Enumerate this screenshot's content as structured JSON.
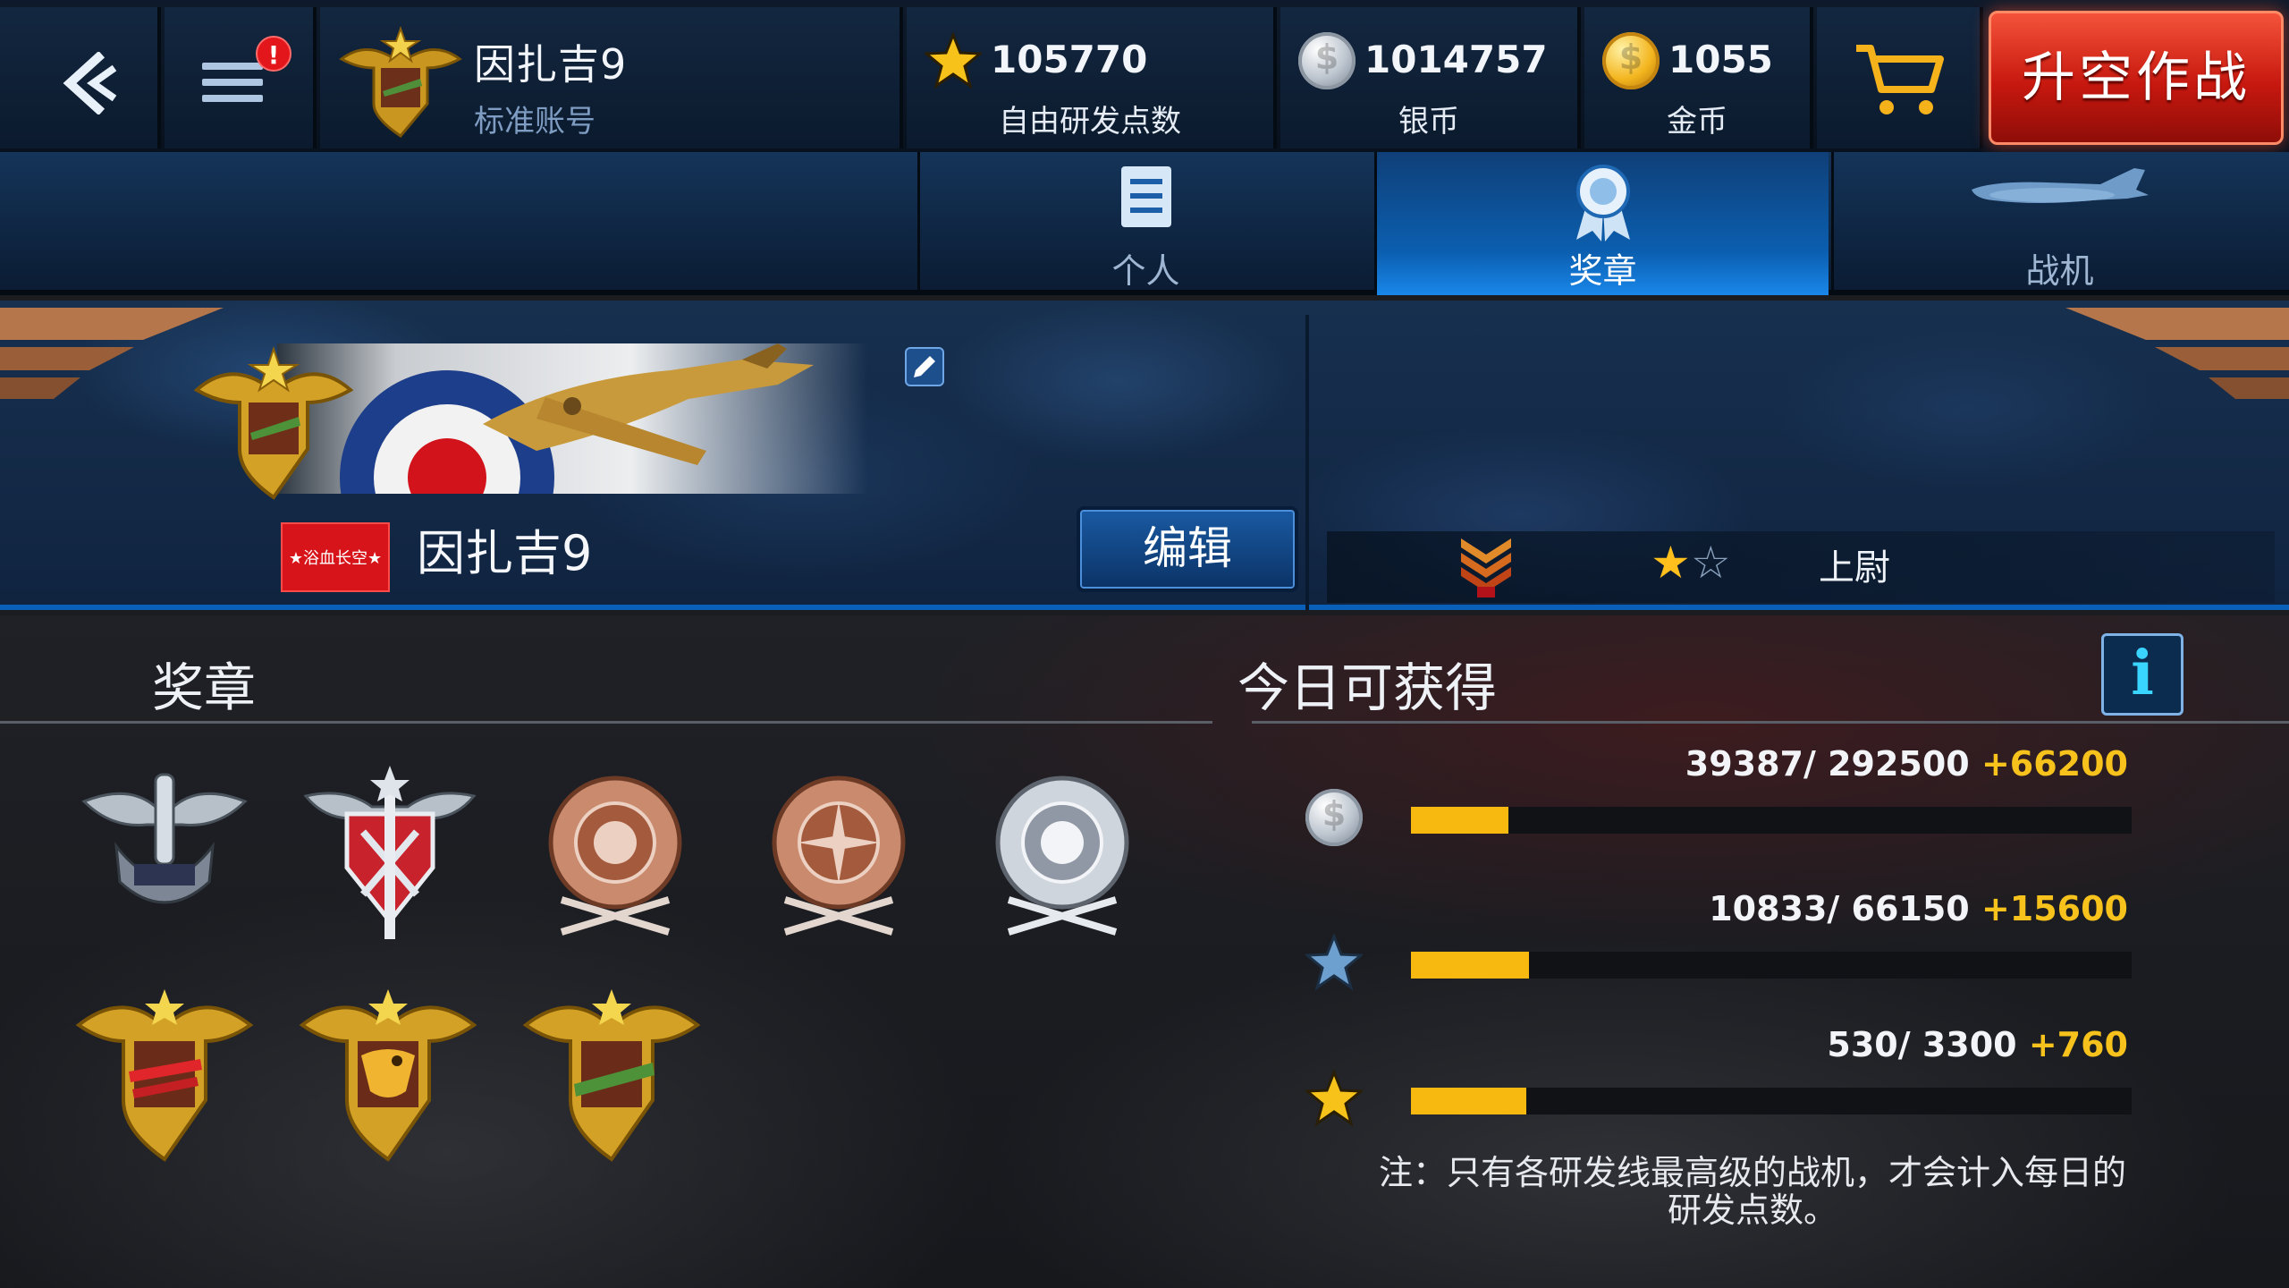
{
  "topbar": {
    "player_name": "因扎吉9",
    "account_type": "标准账号",
    "research_points": {
      "value": "105770",
      "label": "自由研发点数"
    },
    "silver": {
      "value": "1014757",
      "label": "银币"
    },
    "gold": {
      "value": "1055",
      "label": "金币"
    },
    "notification_badge": "!",
    "sortie_label": "升空作战"
  },
  "tabs": [
    {
      "label": "个人",
      "icon": "document-icon",
      "active": false
    },
    {
      "label": "奖章",
      "icon": "medal-ribbon-icon",
      "active": true
    },
    {
      "label": "战机",
      "icon": "aircraft-icon",
      "active": false
    }
  ],
  "profile": {
    "name": "因扎吉9",
    "clan_tag": "★浴血长空★",
    "edit_label": "编辑",
    "rank_stars_filled": 1,
    "rank_stars_total": 2,
    "rank_stars_text": {
      "filled": "★",
      "empty": "☆"
    },
    "rank_title": "上尉"
  },
  "medals_section": {
    "heading": "奖章",
    "medals": [
      "winged-bullet-medal",
      "crossed-swords-shield-medal",
      "bronze-silver-coin-medal",
      "bronze-propeller-medal",
      "silver-coin-medal",
      "gold-red-biplane-badge",
      "gold-eagle-badge",
      "gold-green-fighter-badge"
    ]
  },
  "today_section": {
    "heading": "今日可获得",
    "info_label": "i",
    "rows": [
      {
        "icon": "silver-coin-icon",
        "current": "39387",
        "sep": "/ ",
        "max": "292500",
        "bonus": "+66200",
        "progress": 0.1347
      },
      {
        "icon": "blue-star-icon",
        "current": "10833",
        "sep": "/ ",
        "max": "66150",
        "bonus": "+15600",
        "progress": 0.1638
      },
      {
        "icon": "gold-star-icon",
        "current": "530",
        "sep": "/ ",
        "max": "3300",
        "bonus": "+760",
        "progress": 0.1606
      }
    ],
    "note_line1": "注：只有各研发线最高级的战机，才会计入每日的",
    "note_line2": "研发点数。"
  },
  "colors": {
    "accent_blue": "#0b5fb0",
    "sortie_red": "#c7180f",
    "progress_yellow": "#f7b90f",
    "bonus_yellow": "#f6c21b"
  }
}
